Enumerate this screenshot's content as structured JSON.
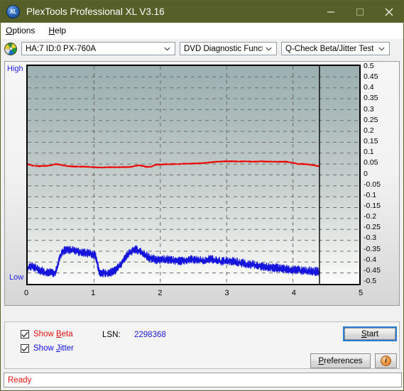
{
  "window": {
    "title": "PlexTools Professional XL V3.16",
    "icon": "xl-app-icon",
    "minimize_label": "Minimize",
    "maximize_label": "Maximize",
    "close_label": "Close",
    "titlebar_color": "#555f27"
  },
  "menu": {
    "items": [
      {
        "label": "Options",
        "accel": "O"
      },
      {
        "label": "Help",
        "accel": "H"
      }
    ]
  },
  "toolbar": {
    "drive_icon": "disc-icon",
    "drive_select": {
      "value": "HA:7 ID:0  PX-760A"
    },
    "function_select": {
      "value": "DVD Diagnostic Functions"
    },
    "test_select": {
      "value": "Q-Check Beta/Jitter Test"
    }
  },
  "chart_data": {
    "type": "line",
    "title": "Q-Check Beta/Jitter Test",
    "xlabel": "",
    "ylabel": "",
    "xlim": [
      0,
      5
    ],
    "ylim": [
      -0.5,
      0.5
    ],
    "xticks": [
      0,
      1,
      2,
      3,
      4,
      5
    ],
    "ytick_labels": [
      "0.5",
      "0.45",
      "0.4",
      "0.35",
      "0.3",
      "0.25",
      "0.2",
      "0.15",
      "0.1",
      "0.05",
      "0",
      "-0.05",
      "-0.1",
      "-0.15",
      "-0.2",
      "-0.25",
      "-0.3",
      "-0.35",
      "-0.4",
      "-0.45",
      "-0.5"
    ],
    "yticks": [
      0.5,
      0.45,
      0.4,
      0.35,
      0.3,
      0.25,
      0.2,
      0.15,
      0.1,
      0.05,
      0,
      -0.05,
      -0.1,
      -0.15,
      -0.2,
      -0.25,
      -0.3,
      -0.35,
      -0.4,
      -0.45,
      -0.5
    ],
    "grid": true,
    "left_axis_top_label": "High",
    "left_axis_bottom_label": "Low",
    "data_end_x": 4.4,
    "series": [
      {
        "name": "Beta",
        "color": "#ee0000",
        "x": [
          0.0,
          0.06,
          0.12,
          0.18,
          0.24,
          0.3,
          0.36,
          0.42,
          0.48,
          0.54,
          0.6,
          0.66,
          0.72,
          0.78,
          0.84,
          0.9,
          0.96,
          1.02,
          1.08,
          1.14,
          1.2,
          1.26,
          1.32,
          1.38,
          1.44,
          1.5,
          1.56,
          1.62,
          1.68,
          1.74,
          1.8,
          1.86,
          1.92,
          1.98,
          2.04,
          2.1,
          2.16,
          2.22,
          2.28,
          2.34,
          2.4,
          2.46,
          2.52,
          2.58,
          2.64,
          2.7,
          2.76,
          2.82,
          2.88,
          2.94,
          3.0,
          3.06,
          3.12,
          3.18,
          3.24,
          3.3,
          3.36,
          3.42,
          3.48,
          3.54,
          3.6,
          3.66,
          3.72,
          3.78,
          3.84,
          3.9,
          3.96,
          4.02,
          4.08,
          4.14,
          4.2,
          4.26,
          4.32,
          4.38,
          4.4
        ],
        "y": [
          0.048,
          0.044,
          0.041,
          0.04,
          0.041,
          0.042,
          0.044,
          0.05,
          0.047,
          0.043,
          0.04,
          0.039,
          0.038,
          0.038,
          0.038,
          0.037,
          0.036,
          0.035,
          0.034,
          0.034,
          0.035,
          0.035,
          0.035,
          0.035,
          0.036,
          0.036,
          0.037,
          0.041,
          0.044,
          0.04,
          0.037,
          0.037,
          0.046,
          0.047,
          0.048,
          0.049,
          0.049,
          0.05,
          0.05,
          0.051,
          0.051,
          0.052,
          0.052,
          0.053,
          0.054,
          0.056,
          0.058,
          0.06,
          0.061,
          0.062,
          0.062,
          0.062,
          0.062,
          0.061,
          0.062,
          0.062,
          0.061,
          0.061,
          0.062,
          0.062,
          0.061,
          0.061,
          0.061,
          0.06,
          0.06,
          0.06,
          0.058,
          0.054,
          0.05,
          0.05,
          0.049,
          0.047,
          0.044,
          0.04,
          0.038
        ]
      },
      {
        "name": "Jitter",
        "color": "#1414dc",
        "x": [
          0.0,
          0.06,
          0.12,
          0.18,
          0.24,
          0.3,
          0.36,
          0.42,
          0.48,
          0.54,
          0.6,
          0.66,
          0.72,
          0.78,
          0.84,
          0.9,
          0.96,
          1.02,
          1.08,
          1.14,
          1.2,
          1.26,
          1.32,
          1.38,
          1.44,
          1.5,
          1.56,
          1.62,
          1.68,
          1.74,
          1.8,
          1.86,
          1.92,
          1.98,
          2.04,
          2.1,
          2.16,
          2.22,
          2.28,
          2.34,
          2.4,
          2.46,
          2.52,
          2.58,
          2.64,
          2.7,
          2.76,
          2.82,
          2.88,
          2.94,
          3.0,
          3.06,
          3.12,
          3.18,
          3.24,
          3.3,
          3.36,
          3.42,
          3.48,
          3.54,
          3.6,
          3.66,
          3.72,
          3.78,
          3.84,
          3.9,
          3.96,
          4.02,
          4.08,
          4.14,
          4.2,
          4.26,
          4.32,
          4.38,
          4.4
        ],
        "y": [
          -0.43,
          -0.42,
          -0.43,
          -0.44,
          -0.445,
          -0.448,
          -0.45,
          -0.452,
          -0.38,
          -0.35,
          -0.345,
          -0.348,
          -0.35,
          -0.355,
          -0.358,
          -0.36,
          -0.365,
          -0.368,
          -0.45,
          -0.452,
          -0.45,
          -0.448,
          -0.44,
          -0.42,
          -0.395,
          -0.37,
          -0.352,
          -0.345,
          -0.348,
          -0.36,
          -0.375,
          -0.385,
          -0.39,
          -0.392,
          -0.39,
          -0.388,
          -0.392,
          -0.395,
          -0.396,
          -0.398,
          -0.392,
          -0.388,
          -0.39,
          -0.392,
          -0.394,
          -0.39,
          -0.386,
          -0.392,
          -0.396,
          -0.398,
          -0.392,
          -0.396,
          -0.4,
          -0.402,
          -0.406,
          -0.41,
          -0.412,
          -0.414,
          -0.418,
          -0.42,
          -0.424,
          -0.426,
          -0.428,
          -0.43,
          -0.432,
          -0.434,
          -0.436,
          -0.438,
          -0.438,
          -0.44,
          -0.44,
          -0.442,
          -0.444,
          -0.446,
          -0.448
        ],
        "noise": 0.022
      }
    ]
  },
  "controls": {
    "show_beta": {
      "label": "Show Beta",
      "accel": "B",
      "checked": true,
      "color": "#e01010"
    },
    "show_jitter": {
      "label": "Show Jitter",
      "accel": "J",
      "checked": true,
      "color": "#1010e0"
    },
    "lsn_label": "LSN:",
    "lsn_value": "2298368",
    "start_button": {
      "label": "Start",
      "accel": "S"
    },
    "preferences_button": {
      "label": "Preferences",
      "accel": "P"
    },
    "info_button": {
      "icon": "info-icon",
      "glyph": "i"
    }
  },
  "status": {
    "text": "Ready",
    "color": "#e01010"
  }
}
